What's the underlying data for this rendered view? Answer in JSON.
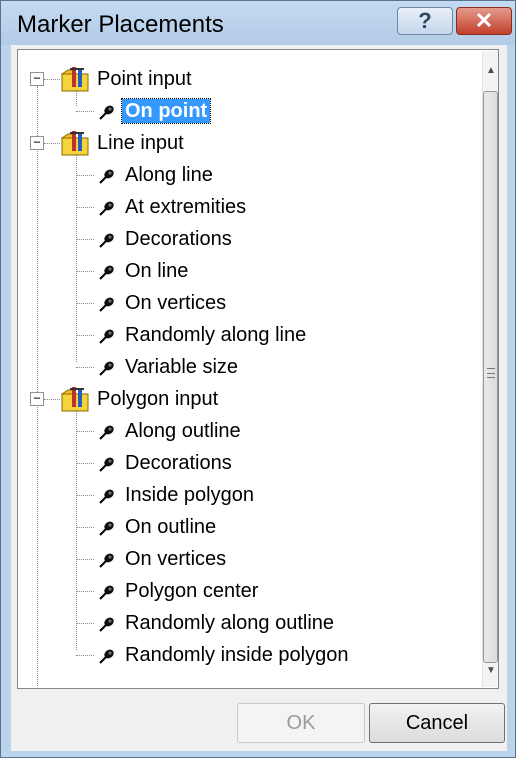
{
  "window": {
    "title": "Marker Placements"
  },
  "titlebar_buttons": {
    "help": "?",
    "close": "✕"
  },
  "tree": {
    "groups": [
      {
        "label": "Point input",
        "expander": "−",
        "icon": "marker-folder-icon",
        "items": [
          {
            "label": "On point",
            "selected": true
          }
        ]
      },
      {
        "label": "Line input",
        "expander": "−",
        "icon": "marker-folder-icon",
        "items": [
          {
            "label": "Along line"
          },
          {
            "label": "At extremities"
          },
          {
            "label": "Decorations"
          },
          {
            "label": "On line"
          },
          {
            "label": "On vertices"
          },
          {
            "label": "Randomly along line"
          },
          {
            "label": "Variable size"
          }
        ]
      },
      {
        "label": "Polygon input",
        "expander": "−",
        "icon": "marker-folder-icon",
        "items": [
          {
            "label": "Along outline"
          },
          {
            "label": "Decorations"
          },
          {
            "label": "Inside polygon"
          },
          {
            "label": "On outline"
          },
          {
            "label": "On vertices"
          },
          {
            "label": "Polygon center"
          },
          {
            "label": "Randomly along outline"
          },
          {
            "label": "Randomly inside polygon"
          }
        ]
      }
    ]
  },
  "buttons": {
    "ok": "OK",
    "ok_enabled": false,
    "cancel": "Cancel"
  },
  "colors": {
    "selection": "#3399ff",
    "titlebar": "#bcd3ec",
    "close": "#c2402c"
  }
}
